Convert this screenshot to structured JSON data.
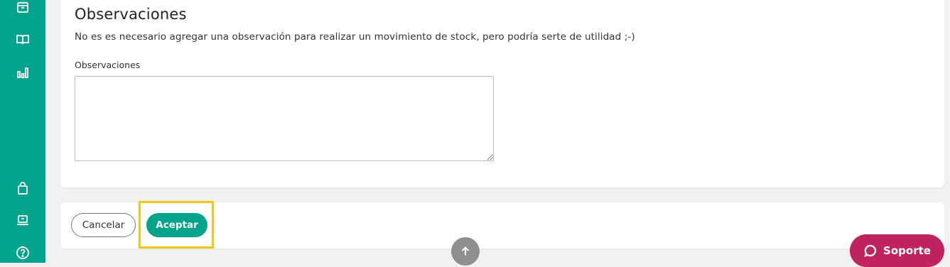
{
  "sidebar": {
    "icons": [
      {
        "name": "box-icon"
      },
      {
        "name": "book-icon"
      },
      {
        "name": "bar-chart-icon"
      },
      {
        "name": "shopping-bag-icon"
      },
      {
        "name": "laptop-icon"
      },
      {
        "name": "help-icon"
      }
    ]
  },
  "observations": {
    "title": "Observaciones",
    "description": "No es es necesario agregar una observación para realizar un movimiento de stock, pero podría serte de utilidad ;-)",
    "field_label": "Observaciones",
    "field_value": ""
  },
  "actions": {
    "cancel_label": "Cancelar",
    "accept_label": "Aceptar"
  },
  "support": {
    "label": "Soporte"
  },
  "colors": {
    "sidebar": "#04a38c",
    "accent": "#04a38c",
    "support": "#c0245d",
    "highlight": "#f5c518"
  }
}
